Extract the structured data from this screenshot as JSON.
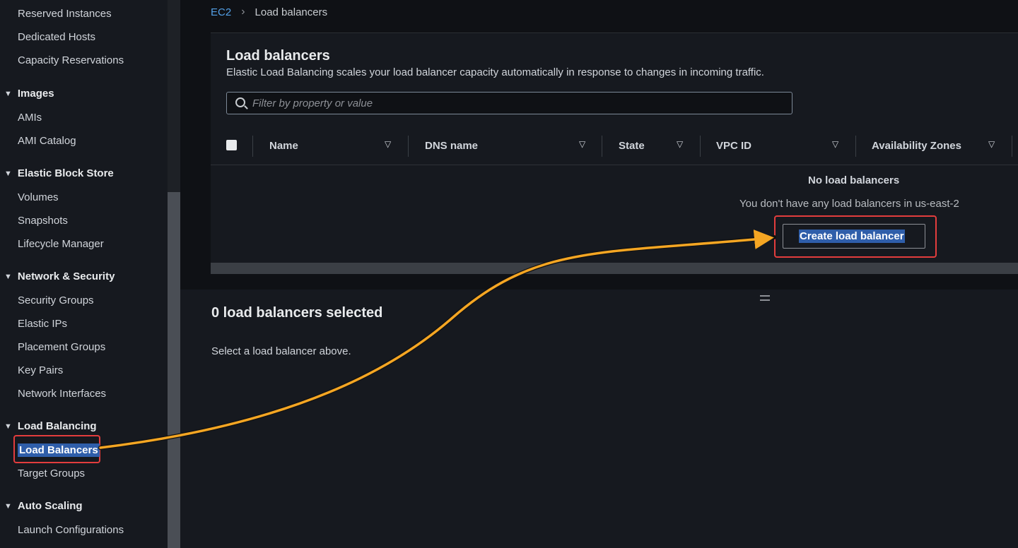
{
  "sidebar": {
    "items_top": [
      "Reserved Instances",
      "Dedicated Hosts",
      "Capacity Reservations"
    ],
    "sections": [
      {
        "title": "Images",
        "items": [
          "AMIs",
          "AMI Catalog"
        ]
      },
      {
        "title": "Elastic Block Store",
        "items": [
          "Volumes",
          "Snapshots",
          "Lifecycle Manager"
        ]
      },
      {
        "title": "Network & Security",
        "items": [
          "Security Groups",
          "Elastic IPs",
          "Placement Groups",
          "Key Pairs",
          "Network Interfaces"
        ]
      },
      {
        "title": "Load Balancing",
        "items": [
          "Load Balancers",
          "Target Groups"
        ]
      },
      {
        "title": "Auto Scaling",
        "items": [
          "Launch Configurations"
        ]
      }
    ],
    "active_item": "Load Balancers"
  },
  "breadcrumb": {
    "root": "EC2",
    "current": "Load balancers"
  },
  "panel": {
    "title": "Load balancers",
    "description": "Elastic Load Balancing scales your load balancer capacity automatically in response to changes in incoming traffic.",
    "filter_placeholder": "Filter by property or value",
    "columns": [
      "Name",
      "DNS name",
      "State",
      "VPC ID",
      "Availability Zones"
    ],
    "empty_title": "No load balancers",
    "empty_desc": "You don't have any load balancers in us-east-2",
    "create_label": "Create load balancer"
  },
  "selection": {
    "title": "0 load balancers selected",
    "description": "Select a load balancer above."
  },
  "colors": {
    "accent_link": "#539fe5",
    "highlight_box": "#e33d3d",
    "arrow": "#f5a623",
    "selection": "#2f5eaa"
  }
}
